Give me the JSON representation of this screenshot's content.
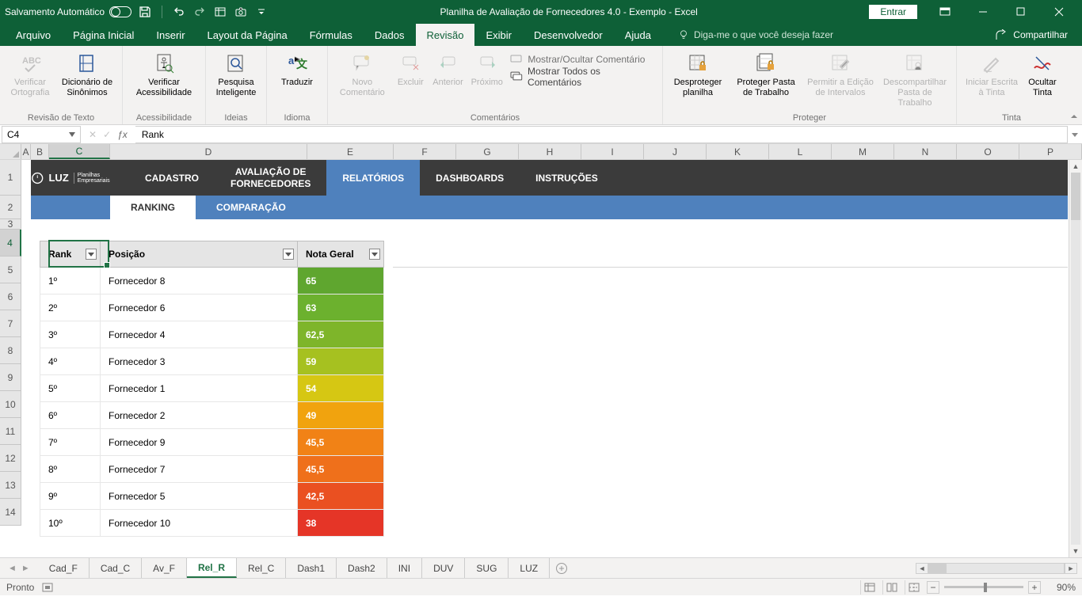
{
  "titlebar": {
    "autosave": "Salvamento Automático",
    "title": "Planilha de Avaliação de Fornecedores 4.0 - Exemplo  -  Excel",
    "signin": "Entrar"
  },
  "menu": {
    "items": [
      "Arquivo",
      "Página Inicial",
      "Inserir",
      "Layout da Página",
      "Fórmulas",
      "Dados",
      "Revisão",
      "Exibir",
      "Desenvolvedor",
      "Ajuda"
    ],
    "active_index": 6,
    "tellme": "Diga-me o que você deseja fazer",
    "share": "Compartilhar"
  },
  "ribbon": {
    "proofing": {
      "spell": "Verificar Ortografia",
      "thesaurus": "Dicionário de Sinônimos",
      "label": "Revisão de Texto"
    },
    "accessibility": {
      "check": "Verificar Acessibilidade",
      "label": "Acessibilidade"
    },
    "insights": {
      "smart": "Pesquisa Inteligente",
      "label": "Ideias"
    },
    "language": {
      "translate": "Traduzir",
      "label": "Idioma"
    },
    "comments": {
      "new": "Novo Comentário",
      "delete": "Excluir",
      "prev": "Anterior",
      "next": "Próximo",
      "show_hide": "Mostrar/Ocultar Comentário",
      "show_all": "Mostrar Todos os Comentários",
      "label": "Comentários"
    },
    "protect": {
      "unprotect_sheet": "Desproteger planilha",
      "protect_wb": "Proteger Pasta de Trabalho",
      "allow_edit": "Permitir a Edição de Intervalos",
      "unshare": "Descompartilhar Pasta de Trabalho",
      "label": "Proteger"
    },
    "ink": {
      "start": "Iniciar Escrita à Tinta",
      "hide": "Ocultar Tinta",
      "label": "Tinta"
    }
  },
  "fbar": {
    "namebox": "C4",
    "formula": "Rank"
  },
  "columns": [
    "A",
    "B",
    "C",
    "D",
    "E",
    "F",
    "G",
    "H",
    "I",
    "J",
    "K",
    "L",
    "M",
    "N",
    "O",
    "P"
  ],
  "nav": {
    "brand": "LUZ",
    "brand_sub": "Planilhas Empresariais",
    "tabs": [
      "CADASTRO",
      "AVALIAÇÃO DE FORNECEDORES",
      "RELATÓRIOS",
      "DASHBOARDS",
      "INSTRUÇÕES"
    ],
    "active_index": 2
  },
  "subnav": {
    "tabs": [
      "RANKING",
      "COMPARAÇÃO"
    ],
    "active_index": 0
  },
  "table": {
    "headers": [
      "Rank",
      "Posição",
      "Nota Geral"
    ],
    "rows": [
      {
        "rank": "1º",
        "pos": "Fornecedor 8",
        "nota": "65",
        "color": "#5fa62f"
      },
      {
        "rank": "2º",
        "pos": "Fornecedor 6",
        "nota": "63",
        "color": "#6cb12e"
      },
      {
        "rank": "3º",
        "pos": "Fornecedor 4",
        "nota": "62,5",
        "color": "#7eb52a"
      },
      {
        "rank": "4º",
        "pos": "Fornecedor 3",
        "nota": "59",
        "color": "#a6c120"
      },
      {
        "rank": "5º",
        "pos": "Fornecedor 1",
        "nota": "54",
        "color": "#d6c713"
      },
      {
        "rank": "6º",
        "pos": "Fornecedor 2",
        "nota": "49",
        "color": "#f1a30e"
      },
      {
        "rank": "7º",
        "pos": "Fornecedor 9",
        "nota": "45,5",
        "color": "#f18216"
      },
      {
        "rank": "8º",
        "pos": "Fornecedor 7",
        "nota": "45,5",
        "color": "#ef701b"
      },
      {
        "rank": "9º",
        "pos": "Fornecedor 5",
        "nota": "42,5",
        "color": "#ea5021"
      },
      {
        "rank": "10º",
        "pos": "Fornecedor 10",
        "nota": "38",
        "color": "#e53527"
      }
    ]
  },
  "sheettabs": {
    "tabs": [
      "Cad_F",
      "Cad_C",
      "Av_F",
      "Rel_R",
      "Rel_C",
      "Dash1",
      "Dash2",
      "INI",
      "DUV",
      "SUG",
      "LUZ"
    ],
    "active_index": 3
  },
  "statusbar": {
    "ready": "Pronto",
    "zoom": "90%"
  }
}
